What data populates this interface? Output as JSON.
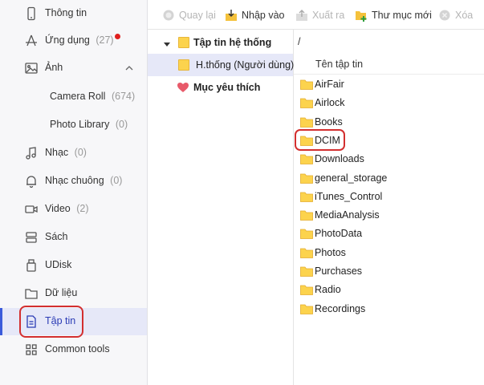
{
  "sidebar": {
    "items": [
      {
        "label": "Thông tin",
        "count": ""
      },
      {
        "label": "Ứng dụng",
        "count": "(27)"
      },
      {
        "label": "Ảnh",
        "count": ""
      },
      {
        "label": "Camera Roll",
        "count": "(674)"
      },
      {
        "label": "Photo Library",
        "count": "(0)"
      },
      {
        "label": "Nhạc",
        "count": "(0)"
      },
      {
        "label": "Nhạc chuông",
        "count": "(0)"
      },
      {
        "label": "Video",
        "count": "(2)"
      },
      {
        "label": "Sách",
        "count": ""
      },
      {
        "label": "UDisk",
        "count": ""
      },
      {
        "label": "Dữ liệu",
        "count": ""
      },
      {
        "label": "Tập tin",
        "count": ""
      },
      {
        "label": "Common tools",
        "count": ""
      }
    ],
    "active_index": 11
  },
  "toolbar": {
    "back": "Quay lại",
    "import": "Nhập vào",
    "export": "Xuất ra",
    "new_folder": "Thư mục mới",
    "delete": "Xóa"
  },
  "tree": {
    "root": "Tập tin hệ thống",
    "child": "H.thống (Người dùng)",
    "favorites": "Mục yêu thích"
  },
  "files": {
    "path": "/",
    "column_name": "Tên tập tin",
    "items": [
      "AirFair",
      "Airlock",
      "Books",
      "DCIM",
      "Downloads",
      "general_storage",
      "iTunes_Control",
      "MediaAnalysis",
      "PhotoData",
      "Photos",
      "Purchases",
      "Radio",
      "Recordings"
    ]
  },
  "colors": {
    "accent": "#3b5bdb",
    "selected_bg": "#e6e8f8",
    "highlight_red": "#d32f2f",
    "folder_yellow": "#fcd34d"
  }
}
